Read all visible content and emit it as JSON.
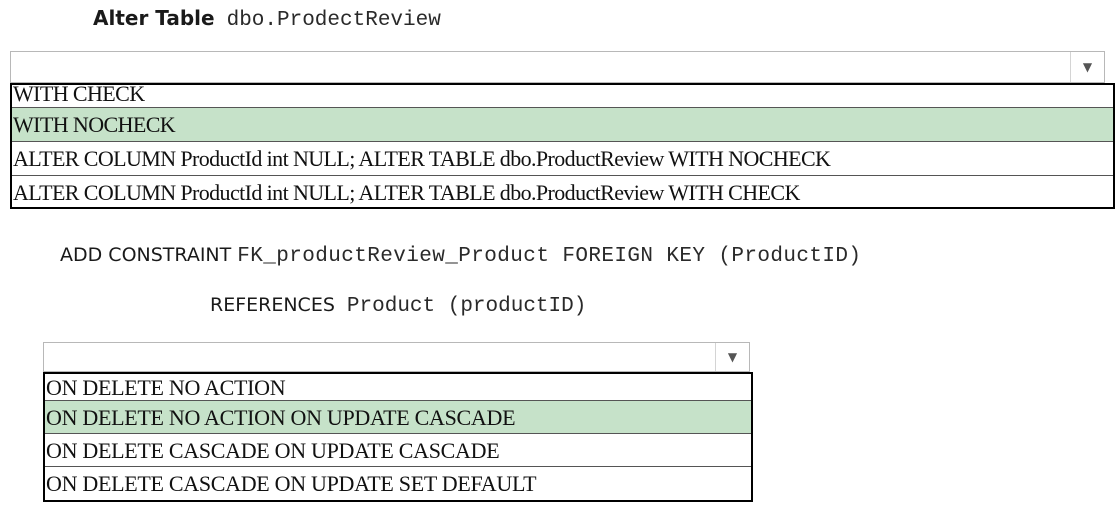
{
  "header": {
    "label": "Alter Table",
    "table_name": "dbo.ProdectReview"
  },
  "dropdown1": {
    "selected_value": "",
    "options": [
      "WITH CHECK",
      "WITH NOCHECK",
      "ALTER COLUMN ProductId int NULL; ALTER TABLE dbo.ProductReview WITH NOCHECK",
      "ALTER COLUMN ProductId int NULL; ALTER TABLE dbo.ProductReview WITH CHECK"
    ],
    "highlighted_option": "WITH NOCHECK"
  },
  "constraint_line": {
    "label": "ADD CONSTRAINT",
    "code": "FK_productReview_Product FOREIGN KEY (ProductID)"
  },
  "references_line": {
    "label": "REFERENCES",
    "code": "Product (productID)"
  },
  "dropdown2": {
    "selected_value": "",
    "options": [
      "ON DELETE NO ACTION",
      "ON DELETE NO ACTION ON UPDATE CASCADE",
      "ON DELETE CASCADE ON UPDATE CASCADE",
      "ON DELETE CASCADE ON UPDATE SET DEFAULT"
    ],
    "highlighted_option": "ON DELETE NO ACTION ON UPDATE CASCADE"
  },
  "icons": {
    "dropdown_arrow": "chevron-down-icon"
  },
  "colors": {
    "highlight": "#c6e2c9",
    "list_border": "#000000"
  }
}
